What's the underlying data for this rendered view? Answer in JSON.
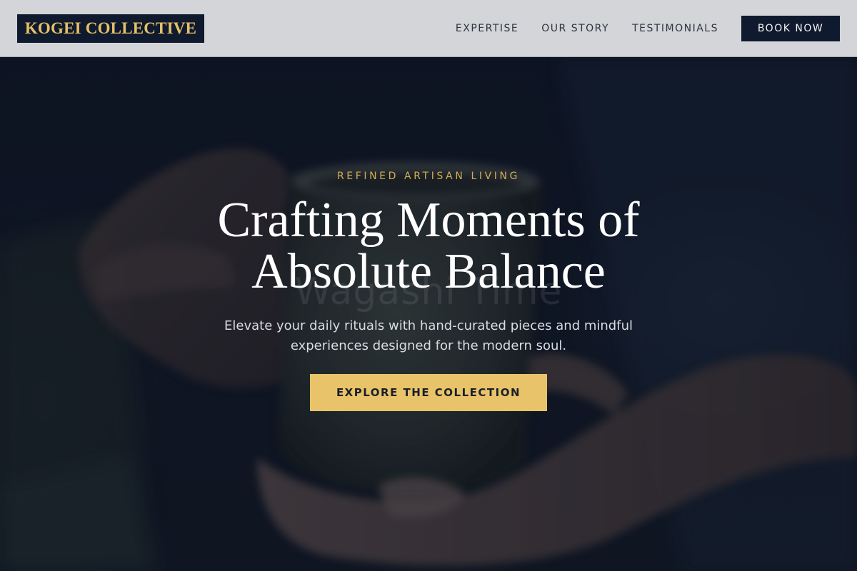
{
  "brand": {
    "name": "KOGEI COLLECTIVE"
  },
  "nav": {
    "links": [
      "EXPERTISE",
      "OUR STORY",
      "TESTIMONIALS"
    ],
    "cta_label": "BOOK NOW"
  },
  "hero": {
    "eyebrow": "REFINED ARTISAN LIVING",
    "headline_line1": "Crafting Moments of",
    "headline_line2": "Absolute Balance",
    "ghost_text": "Wagashi Time",
    "subtitle": "Elevate your daily rituals with hand-curated pieces and mindful experiences designed for the modern soul.",
    "cta_label": "EXPLORE THE COLLECTION",
    "photo_subject": "hands-holding-ceramic-cup-image"
  },
  "colors": {
    "nav_bg": "#d4d5d8",
    "navy": "#101a2e",
    "gold": "#e8c369",
    "gold_text": "#d3ad57",
    "hero_bg": "#0f1828"
  }
}
